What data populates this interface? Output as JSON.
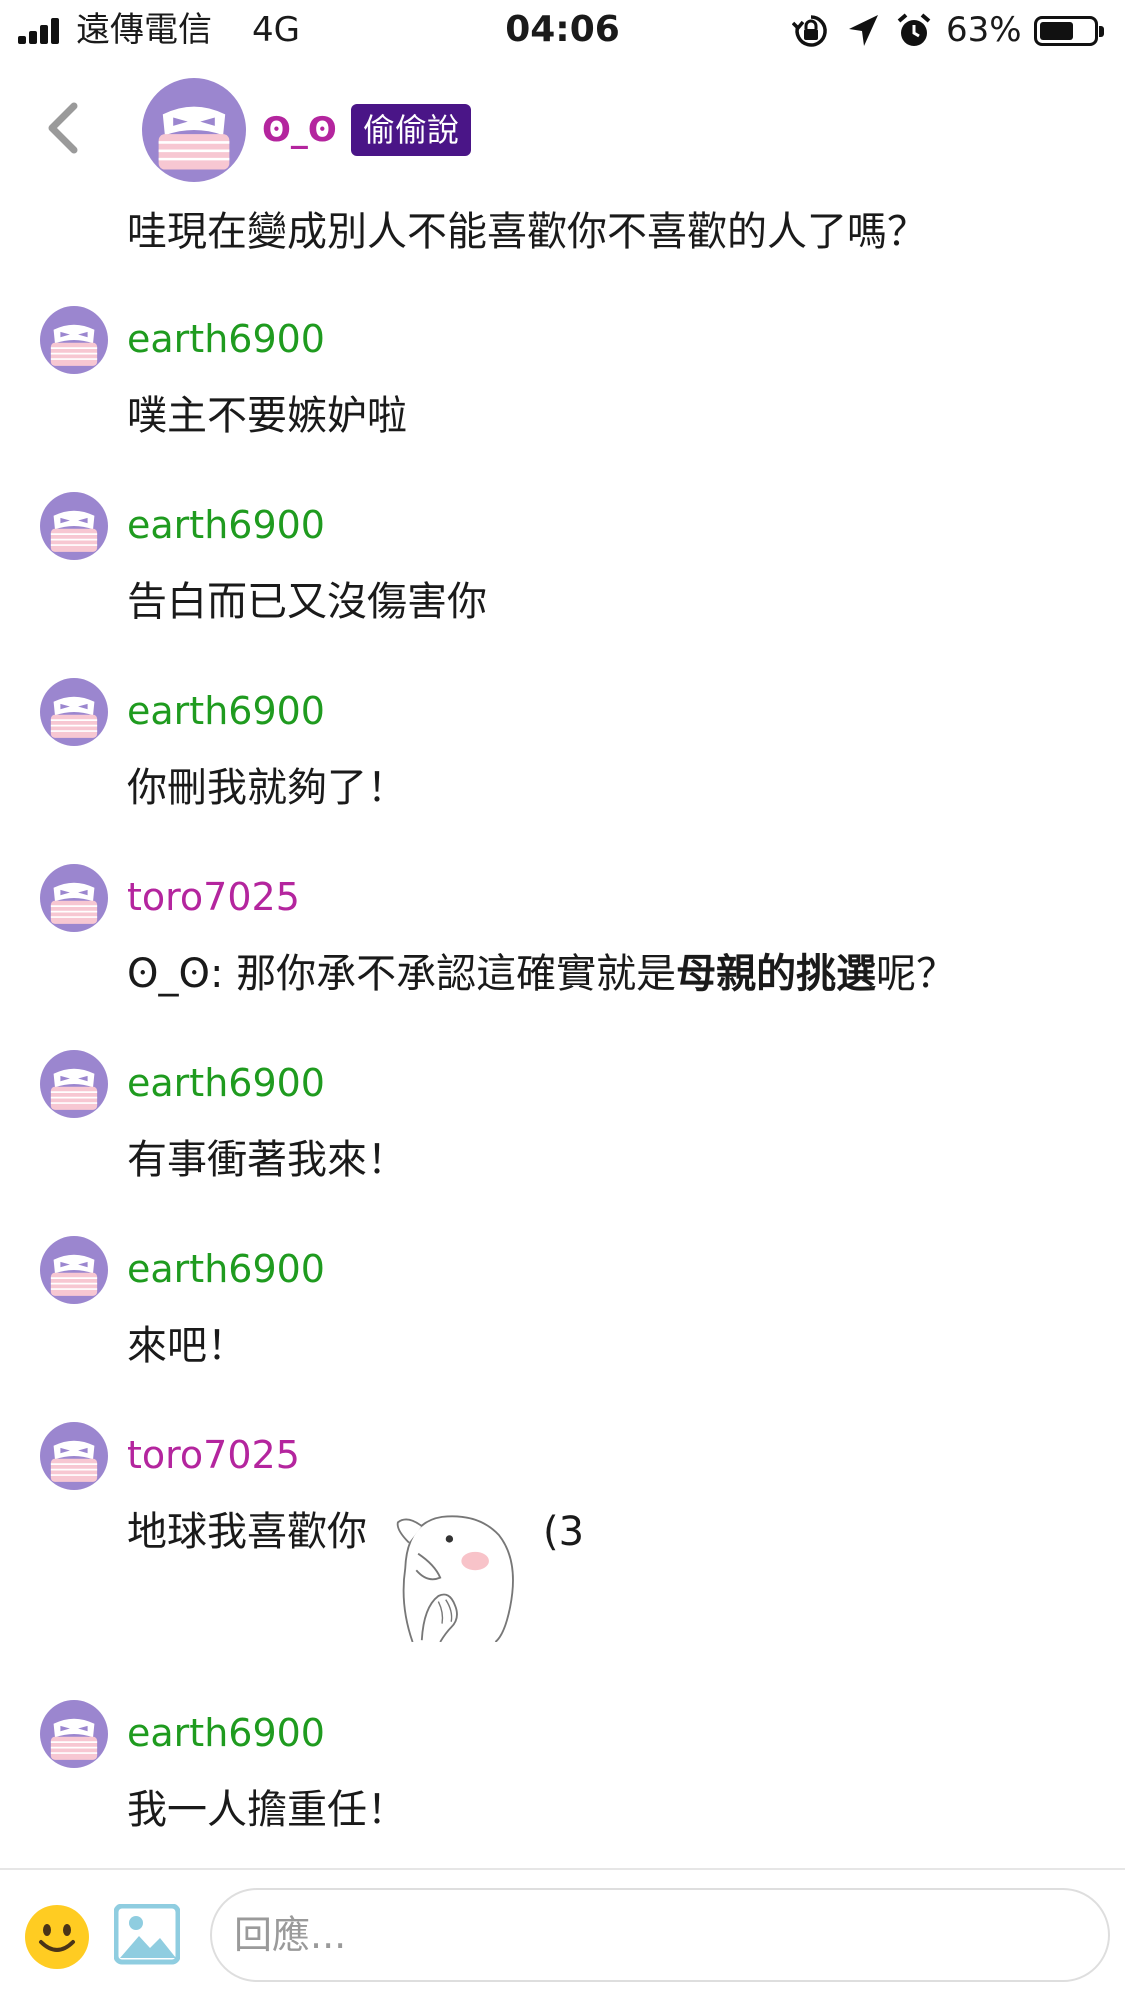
{
  "status_bar": {
    "carrier": "遠傳電信",
    "network": "4G",
    "time": "04:06",
    "battery": "63%",
    "battery_level": 0.63,
    "icons": [
      "orientation-lock-icon",
      "location-arrow-icon",
      "alarm-icon"
    ]
  },
  "owner_post": {
    "name": "ʘ_ʘ",
    "badge": "偷偷說",
    "content": "哇現在變成別人不能喜歡你不喜歡的人了嗎？"
  },
  "responses": [
    {
      "user": "earth6900",
      "color": "#1f9b1f",
      "text": "噗主不要嫉妒啦"
    },
    {
      "user": "earth6900",
      "color": "#1f9b1f",
      "text": "告白而已又沒傷害你"
    },
    {
      "user": "earth6900",
      "color": "#1f9b1f",
      "text": "你刪我就夠了！"
    },
    {
      "user": "toro7025",
      "color": "#b4259e",
      "text_pre": "ʘ_ʘ: 那你承不承認這確實就是",
      "text_bold": "母親的挑選",
      "text_post": "呢？"
    },
    {
      "user": "earth6900",
      "color": "#1f9b1f",
      "text": "有事衝著我來！"
    },
    {
      "user": "earth6900",
      "color": "#1f9b1f",
      "text": "來吧！"
    },
    {
      "user": "toro7025",
      "color": "#b4259e",
      "text_pre": "地球我喜歡你",
      "sticker": "blushing-creature-sticker",
      "text_post": "(3"
    },
    {
      "user": "earth6900",
      "color": "#1f9b1f",
      "text": "我一人擔重任！"
    }
  ],
  "composer": {
    "emoji_icon": "smiley-face-icon",
    "image_icon": "image-upload-icon",
    "placeholder": "回應..."
  },
  "colors": {
    "avatar_purple": "#9b86cf",
    "badge_purple": "#4a1587",
    "green_user": "#1f9b1f",
    "magenta_user": "#b4259e"
  }
}
